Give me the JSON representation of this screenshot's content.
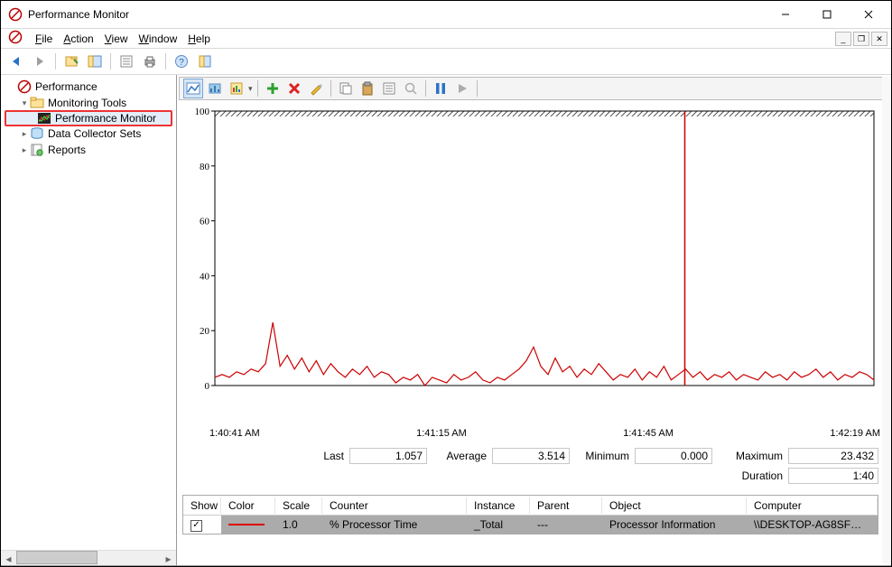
{
  "title": "Performance Monitor",
  "menu": {
    "file": "File",
    "action": "Action",
    "view": "View",
    "window": "Window",
    "help": "Help"
  },
  "tree": {
    "root": "Performance",
    "monitoring_tools": "Monitoring Tools",
    "performance_monitor": "Performance Monitor",
    "data_collector_sets": "Data Collector Sets",
    "reports": "Reports"
  },
  "chart_data": {
    "type": "line",
    "title": "",
    "ylabel": "",
    "ylim": [
      0,
      100
    ],
    "yticks": [
      0,
      20,
      40,
      60,
      80,
      100
    ],
    "x_time_labels": [
      "1:40:41 AM",
      "1:41:15 AM",
      "1:41:45 AM",
      "1:42:19 AM"
    ],
    "cursor_x_pct": 71.3,
    "series": [
      {
        "name": "% Processor Time",
        "color": "#cc0000",
        "values": [
          3,
          4,
          3,
          5,
          4,
          6,
          5,
          8,
          23,
          7,
          11,
          6,
          10,
          5,
          9,
          4,
          8,
          5,
          3,
          6,
          4,
          7,
          3,
          5,
          4,
          1,
          3,
          2,
          4,
          0,
          3,
          2,
          1,
          4,
          2,
          3,
          5,
          2,
          1,
          3,
          2,
          4,
          6,
          9,
          14,
          7,
          4,
          10,
          5,
          7,
          3,
          6,
          4,
          8,
          5,
          2,
          4,
          3,
          6,
          2,
          5,
          3,
          7,
          2,
          4,
          6,
          3,
          5,
          2,
          4,
          3,
          5,
          2,
          4,
          3,
          2,
          5,
          3,
          4,
          2,
          5,
          3,
          4,
          6,
          3,
          5,
          2,
          4,
          3,
          5,
          4,
          2
        ]
      }
    ]
  },
  "stats": {
    "last_label": "Last",
    "last": "1.057",
    "average_label": "Average",
    "average": "3.514",
    "minimum_label": "Minimum",
    "minimum": "0.000",
    "maximum_label": "Maximum",
    "maximum": "23.432",
    "duration_label": "Duration",
    "duration": "1:40"
  },
  "counters": {
    "headers": {
      "show": "Show",
      "color": "Color",
      "scale": "Scale",
      "counter": "Counter",
      "instance": "Instance",
      "parent": "Parent",
      "object": "Object",
      "computer": "Computer"
    },
    "rows": [
      {
        "show": true,
        "scale": "1.0",
        "counter": "% Processor Time",
        "instance": "_Total",
        "parent": "---",
        "object": "Processor Information",
        "computer": "\\\\DESKTOP-AG8SF…"
      }
    ]
  }
}
